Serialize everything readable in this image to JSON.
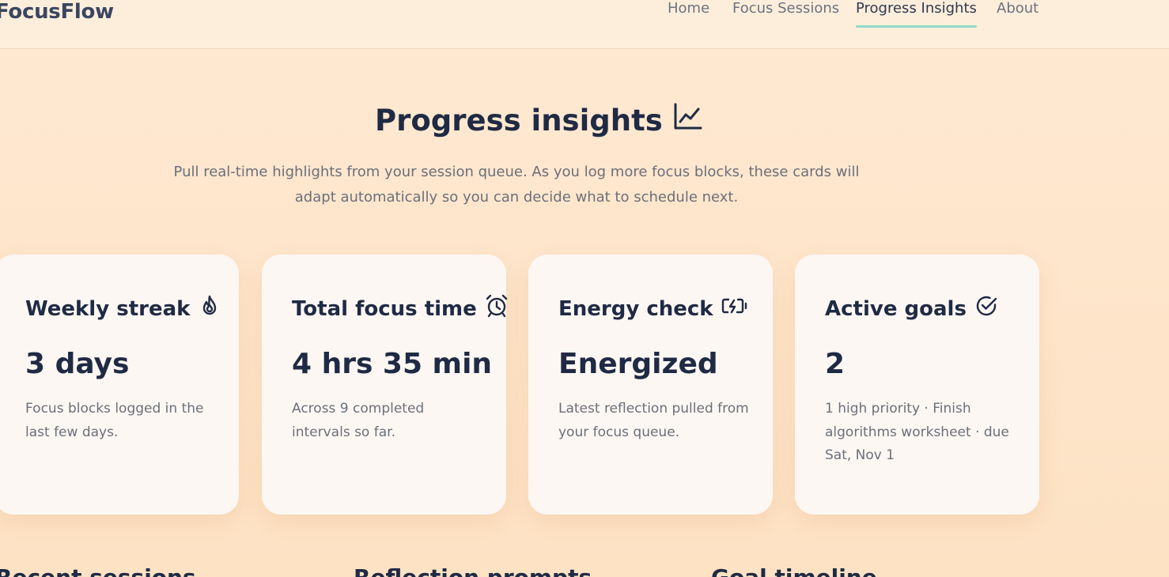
{
  "header": {
    "brand": "FocusFlow",
    "nav": [
      {
        "label": "Home"
      },
      {
        "label": "Focus Sessions"
      },
      {
        "label": "Progress Insights",
        "active": true
      },
      {
        "label": "About"
      }
    ]
  },
  "hero": {
    "title": "Progress insights",
    "title_icon": "chart-line-icon",
    "subtitle": "Pull real-time highlights from your session queue. As you log more focus blocks, these cards will adapt automatically so you can decide what to schedule next."
  },
  "cards": [
    {
      "title": "Weekly streak",
      "icon": "flame-icon",
      "value": "3 days",
      "desc": "Focus blocks logged in the last few days."
    },
    {
      "title": "Total focus time",
      "icon": "alarm-clock-icon",
      "value": "4 hrs 35 min",
      "desc": "Across 9 completed intervals so far."
    },
    {
      "title": "Energy check",
      "icon": "battery-charging-icon",
      "value": "Energized",
      "desc": "Latest reflection pulled from your focus queue."
    },
    {
      "title": "Active goals",
      "icon": "check-circle-icon",
      "value": "2",
      "desc": "1 high priority · Finish algorithms worksheet · due Sat, Nov 1"
    }
  ],
  "sections": [
    {
      "title": "Recent sessions"
    },
    {
      "title": "Reflection prompts"
    },
    {
      "title": "Goal timeline"
    }
  ],
  "colors": {
    "accent_underline": "#8fdac9",
    "text_dark": "#1f2a44",
    "text_muted": "#6b6f7a"
  }
}
